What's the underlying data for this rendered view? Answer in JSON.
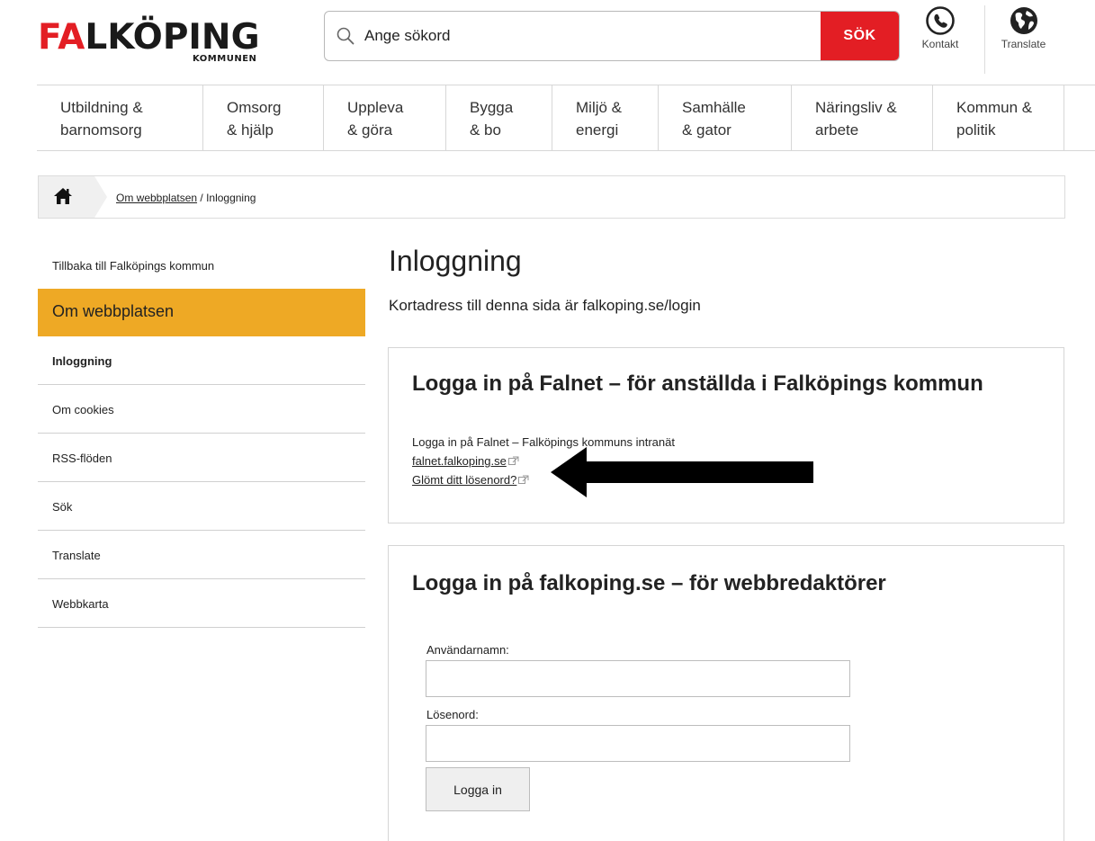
{
  "brand": {
    "logo_accent": "FA",
    "logo_rest": "LKÖPING",
    "logo_sub": "KOMMUNEN",
    "accent_color": "#e31e24"
  },
  "search": {
    "placeholder": "Ange sökord",
    "button_label": "SÖK",
    "icon": "search-icon"
  },
  "header_tools": {
    "contact_label": "Kontakt",
    "contact_icon": "phone-icon",
    "translate_label": "Translate",
    "translate_icon": "globe-icon"
  },
  "mainnav": {
    "items": [
      {
        "line1": "Utbildning &",
        "line2": "barnomsorg"
      },
      {
        "line1": "Omsorg",
        "line2": "& hjälp"
      },
      {
        "line1": "Uppleva",
        "line2": "& göra"
      },
      {
        "line1": "Bygga",
        "line2": "& bo"
      },
      {
        "line1": "Miljö &",
        "line2": "energi"
      },
      {
        "line1": "Samhälle",
        "line2": "& gator"
      },
      {
        "line1": "Näringsliv &",
        "line2": "arbete"
      },
      {
        "line1": "Kommun &",
        "line2": "politik"
      }
    ]
  },
  "breadcrumb": {
    "home_icon": "home-icon",
    "parent": "Om webbplatsen",
    "separator": " / ",
    "current": "Inloggning"
  },
  "sidebar": {
    "back_label": "Tillbaka till Falköpings kommun",
    "section_label": "Om webbplatsen",
    "section_color": "#eea925",
    "items": [
      {
        "label": "Inloggning"
      },
      {
        "label": "Om cookies"
      },
      {
        "label": "RSS-flöden"
      },
      {
        "label": "Sök"
      },
      {
        "label": "Translate"
      },
      {
        "label": "Webbkarta"
      }
    ]
  },
  "main": {
    "title": "Inloggning",
    "short_address": "Kortadress till denna sida är falkoping.se/login",
    "falnet_box": {
      "title": "Logga in på Falnet – för anställda i Falköpings kommun",
      "lead": "Logga in på Falnet – Falköpings kommuns intranät",
      "link1": "falnet.falkoping.se",
      "link2": "Glömt ditt lösenord?"
    },
    "editor_box": {
      "title": "Logga in på falkoping.se – för webbredaktörer",
      "username_label": "Användarnamn:",
      "username_value": "",
      "password_label": "Lösenord:",
      "password_value": "",
      "submit_label": "Logga in"
    }
  }
}
